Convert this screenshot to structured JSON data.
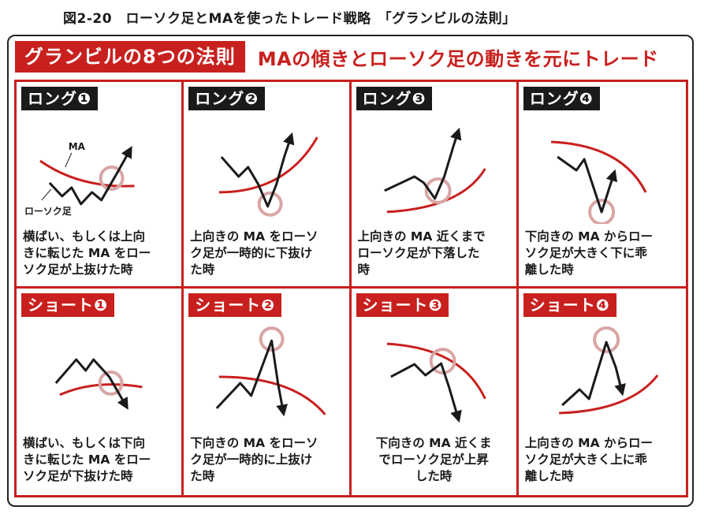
{
  "caption": "図2-20　ローソク足とMAを使ったトレード戦略　「グランビルの法則」",
  "title": "グランビルの8つの法則",
  "subtitle": "MAの傾きとローソク足の動きを元にトレード",
  "colors": {
    "red": "#c8201e",
    "black": "#1a1a1a",
    "circle": "#d9a5a5"
  },
  "annotations": {
    "ma": "MA",
    "candle": "ローソク足"
  },
  "cells": [
    {
      "label": "ロング❶",
      "desc": "横ばい、もしくは上向\nきに転じた MA をロー\nソク足が上抜けた時"
    },
    {
      "label": "ロング❷",
      "desc": "上向きの MA をローソ\nク足が一時的に下抜け\nた時"
    },
    {
      "label": "ロング❸",
      "desc": "上向きの MA 近くまで\nローソク足が下落した\n時"
    },
    {
      "label": "ロング❹",
      "desc": "下向きの MA からロー\nソク足が大きく下に乖\n離した時"
    },
    {
      "label": "ショート❶",
      "desc": "横ばい、もしくは下向\nきに転じた MA をロー\nソク足が下抜けた時"
    },
    {
      "label": "ショート❷",
      "desc": "下向きの MA をローソ\nク足が一時的に上抜け\nた時"
    },
    {
      "label": "ショート❸",
      "desc": "下向きの MA 近くま\nでローソク足が上昇\nした時"
    },
    {
      "label": "ショート❹",
      "desc": "上向きの MA からロー\nソク足が大きく上に乖\n離した時"
    }
  ]
}
